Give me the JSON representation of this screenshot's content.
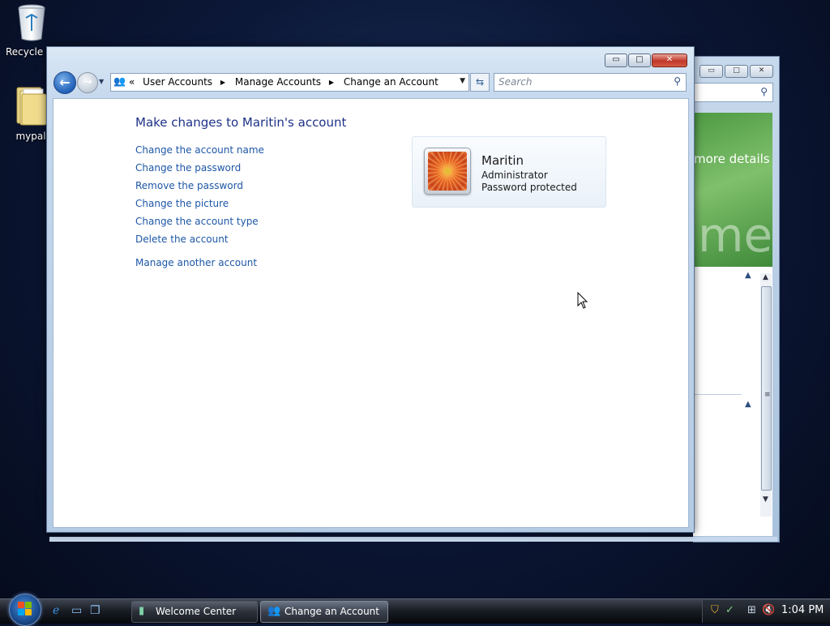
{
  "desktop": {
    "icons": [
      {
        "label": "Recycle Bin",
        "icon": "recycle-bin-icon"
      },
      {
        "label": "mypal",
        "icon": "folder-icon"
      }
    ]
  },
  "back_window": {
    "banner_text": "more details",
    "banner_watermark": "me"
  },
  "window": {
    "title": "Change an Account",
    "controls": {
      "minimize": "▭",
      "maximize": "□",
      "close": "✕"
    },
    "address": {
      "overflow": "«",
      "crumbs": [
        "User Accounts",
        "Manage Accounts",
        "Change an Account"
      ]
    },
    "search": {
      "placeholder": "Search"
    }
  },
  "page": {
    "title": "Make changes to Maritin's account",
    "tasks": [
      "Change the account name",
      "Change the password",
      "Remove the password",
      "Change the picture",
      "Change the account type",
      "Delete the account"
    ],
    "other_task": "Manage another account"
  },
  "account": {
    "name": "Maritin",
    "type": "Administrator",
    "status": "Password protected"
  },
  "taskbar": {
    "buttons": [
      {
        "label": "Welcome Center",
        "icon": "welcome-center-icon",
        "active": false
      },
      {
        "label": "Change an Account",
        "icon": "user-accounts-icon",
        "active": true
      }
    ],
    "quick_launch": [
      "internet-explorer-icon",
      "show-desktop-icon",
      "switch-windows-icon"
    ],
    "clock": "1:04 PM"
  }
}
